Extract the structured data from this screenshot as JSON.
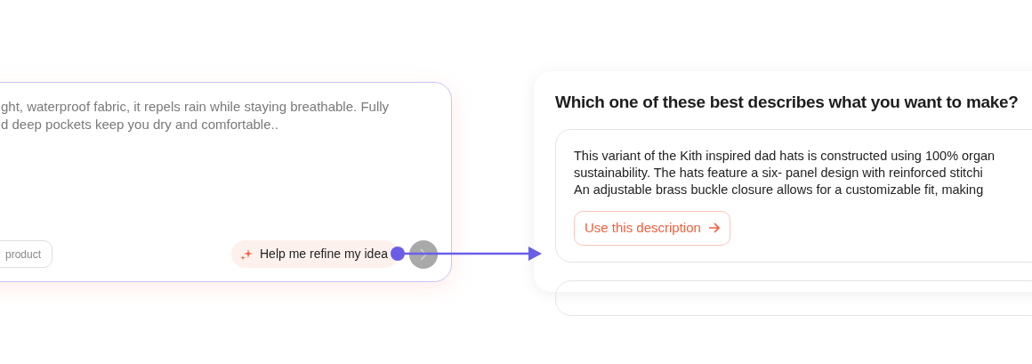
{
  "prompt_card": {
    "text_lines": [
      "ght, waterproof fabric, it repels rain while staying breathable. Fully",
      "d deep pockets keep you dry and comfortable.."
    ],
    "chip": "product",
    "refine_button": "Help me refine my idea",
    "send_disabled": true
  },
  "options_panel": {
    "title": "Which one of these best describes what you want to make?",
    "options": [
      {
        "text_lines": [
          "This variant of the Kith inspired dad hats is constructed using 100% organ",
          "sustainability. The hats feature a six- panel design with reinforced stitchi",
          "An adjustable brass buckle closure allows for a customizable fit, making"
        ],
        "button": "Use this description"
      }
    ]
  }
}
